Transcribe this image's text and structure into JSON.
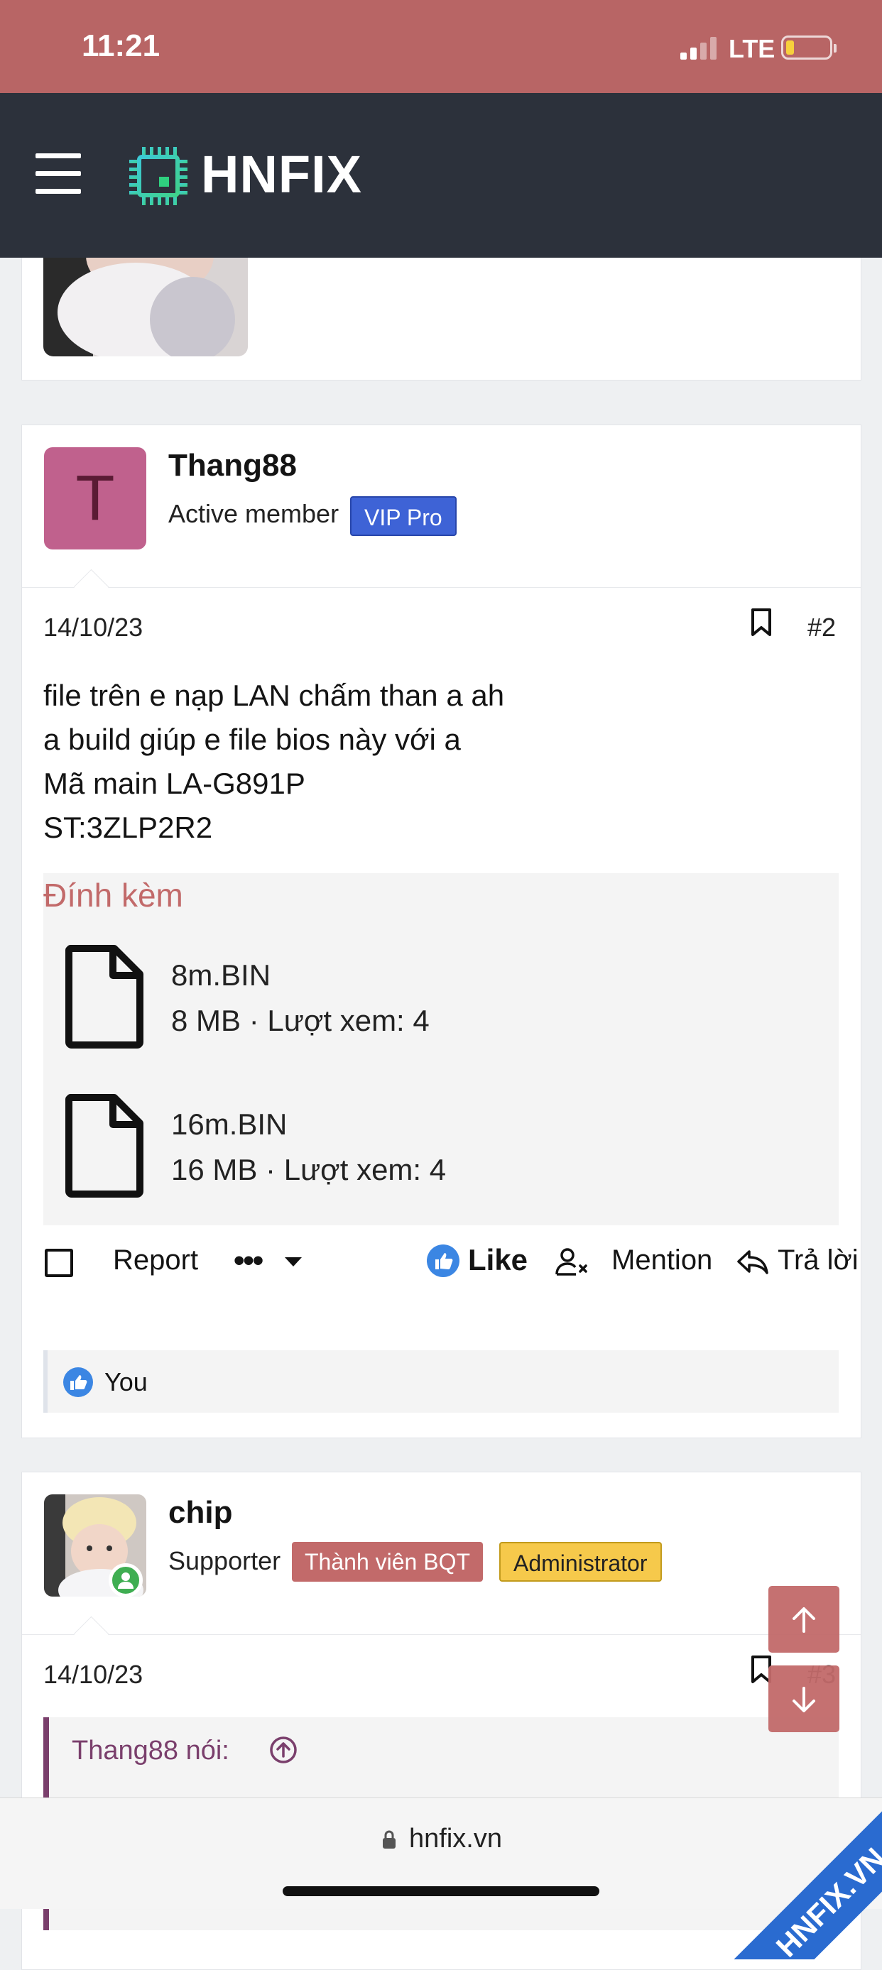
{
  "status_bar": {
    "time": "11:21",
    "network": "LTE"
  },
  "nav": {
    "logo_text": "HNFIX"
  },
  "posts": [
    {
      "username": "Thang88",
      "avatar_letter": "T",
      "user_title": "Active member",
      "badges": [
        "VIP Pro"
      ],
      "date": "14/10/23",
      "post_number": "#2",
      "body_lines": [
        "file trên e nạp LAN chấm than a ah",
        "a build giúp e file bios này với a",
        "Mã main LA-G891P",
        "ST:3ZLP2R2"
      ],
      "attachments_title": "Đính kèm",
      "attachments": [
        {
          "name": "8m.BIN",
          "meta": "8 MB · Lượt xem: 4"
        },
        {
          "name": "16m.BIN",
          "meta": "16 MB · Lượt xem: 4"
        }
      ],
      "actions": {
        "report": "Report",
        "more": "•••",
        "like": "Like",
        "mention": "Mention",
        "reply": "Trả lời"
      },
      "reactions": {
        "names": "You"
      }
    },
    {
      "username": "chip",
      "user_title": "Supporter",
      "badges": [
        "Thành viên BQT",
        "Administrator"
      ],
      "date": "14/10/23",
      "post_number": "#3",
      "quote_label": "Thang88 nói:"
    }
  ],
  "browser": {
    "domain": "hnfix.vn"
  },
  "watermark": "HNFIX.VN",
  "colors": {
    "status_bar": "#b86565",
    "navbar": "#2c313b",
    "accent": "#c26a6a",
    "vip_badge": "#3e63d6",
    "admin_badge": "#f6c94b",
    "like_blue": "#3b86e3"
  }
}
